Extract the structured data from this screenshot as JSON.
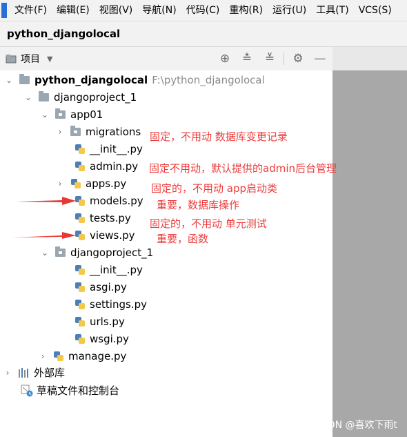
{
  "menu": [
    "文件(F)",
    "编辑(E)",
    "视图(V)",
    "导航(N)",
    "代码(C)",
    "重构(R)",
    "运行(U)",
    "工具(T)",
    "VCS(S)"
  ],
  "window_title": "python_djangolocal",
  "toolbar": {
    "view_label": "项目",
    "icons": [
      "locate-icon",
      "expand-all-icon",
      "collapse-all-icon",
      "gear-icon",
      "minimize-icon"
    ]
  },
  "tree": {
    "root": {
      "name": "python_djangolocal",
      "path": "F:\\python_djangolocal"
    },
    "djangoproject_1": "djangoproject_1",
    "app01": "app01",
    "migrations": "migrations",
    "app_init": "__init__.py",
    "admin": "admin.py",
    "apps": "apps.py",
    "models": "models.py",
    "tests": "tests.py",
    "views": "views.py",
    "inner_project": "djangoproject_1",
    "inner_init": "__init__.py",
    "asgi": "asgi.py",
    "settings": "settings.py",
    "urls": "urls.py",
    "wsgi": "wsgi.py",
    "manage": "manage.py",
    "external": "外部库",
    "scratches": "草稿文件和控制台"
  },
  "annotations": {
    "migrations": "固定，不用动  数据库变更记录",
    "admin": "固定不用动，默认提供的admin后台管理",
    "apps": "固定的，不用动     app启动类",
    "models": "重要，数据库操作",
    "tests": "固定的，不用动    单元测试",
    "views": "重要，函数"
  },
  "watermark": "CSDN @喜欢下雨t",
  "colors": {
    "annotation": "#ee3b3b",
    "arrow": "#e53935",
    "folder": "#9aa7b0",
    "scrollbar": "#a8a8a8"
  }
}
